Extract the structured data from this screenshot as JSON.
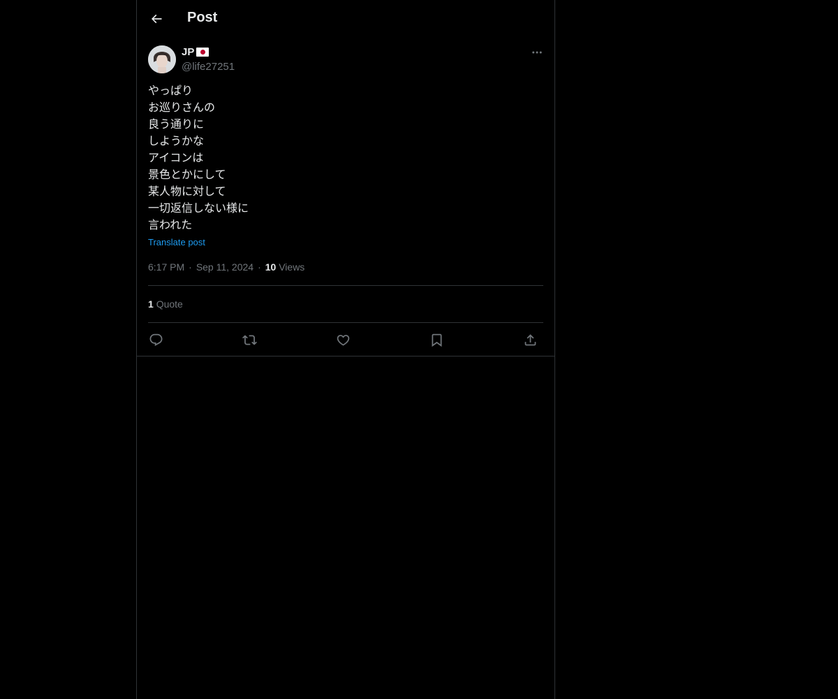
{
  "header": {
    "title": "Post"
  },
  "author": {
    "name": "JP",
    "handle": "@life27251"
  },
  "post": {
    "text": "やっぱり\nお巡りさんの\n良う通りに\nしようかな\nアイコンは\n景色とかにして\n某人物に対して\n一切返信しない様に\n言われた",
    "translate_label": "Translate post",
    "time": "6:17 PM",
    "date": "Sep 11, 2024",
    "separator": "·",
    "views_count": "10",
    "views_label": "Views"
  },
  "stats": {
    "quotes_count": "1",
    "quotes_label": "Quote"
  },
  "icons": {
    "back": "arrow-left-icon",
    "more": "more-horizontal-icon",
    "reply": "reply-icon",
    "repost": "repost-icon",
    "like": "heart-icon",
    "bookmark": "bookmark-icon",
    "share": "share-icon"
  },
  "colors": {
    "background": "#000000",
    "text": "#e7e9ea",
    "muted": "#71767b",
    "link": "#1d9bf0",
    "border": "#2f3336"
  }
}
